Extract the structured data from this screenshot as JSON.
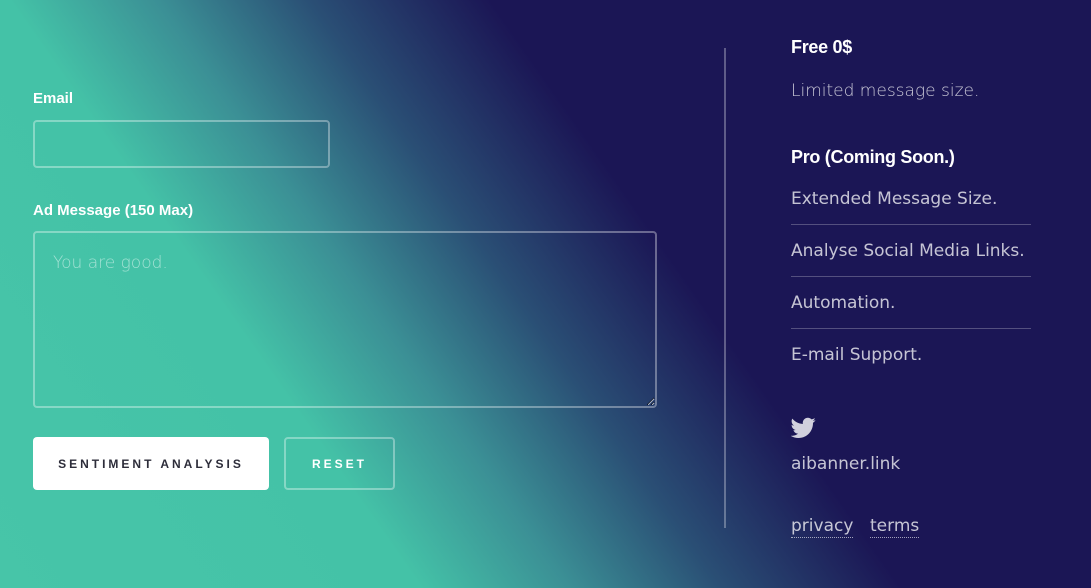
{
  "form": {
    "email_label": "Email",
    "email_value": "",
    "message_label": "Ad Message (150 Max)",
    "message_placeholder": "You are good.",
    "submit_label": "SENTIMENT ANALYSIS",
    "reset_label": "RESET"
  },
  "plans": {
    "free_title": "Free 0$",
    "free_desc": "Limited message size.",
    "pro_title": "Pro (Coming Soon.)",
    "pro_features": [
      "Extended Message Size.",
      "Analyse Social Media Links.",
      "Automation.",
      "E-mail Support."
    ]
  },
  "social": {
    "icon": "twitter-icon",
    "site": "aibanner.link"
  },
  "footer": {
    "privacy_label": "privacy",
    "terms_label": "terms"
  },
  "colors": {
    "bg_dark": "#1b1655",
    "bg_teal": "#47c5a8",
    "button_bg": "#ffffff",
    "button_text": "#2d2d3a"
  }
}
